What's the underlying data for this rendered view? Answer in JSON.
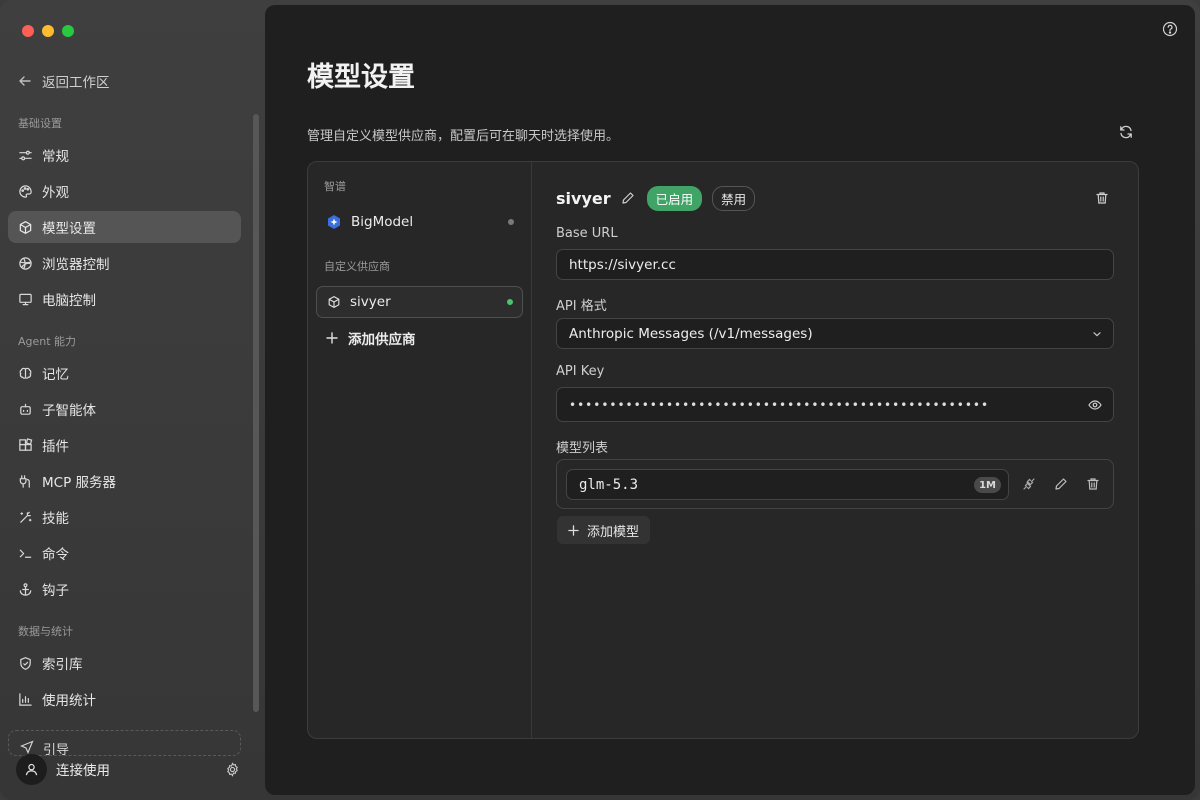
{
  "sidebar": {
    "back_label": "返回工作区",
    "sections": {
      "basic": "基础设置",
      "agent": "Agent 能力",
      "data": "数据与统计"
    },
    "items": {
      "general": "常规",
      "appearance": "外观",
      "models": "模型设置",
      "browser": "浏览器控制",
      "computer": "电脑控制",
      "memory": "记忆",
      "subagents": "子智能体",
      "plugins": "插件",
      "mcp": "MCP 服务器",
      "skills": "技能",
      "commands": "命令",
      "hooks": "钩子",
      "index": "索引库",
      "usage": "使用统计"
    },
    "bottom_peek": "引导",
    "user_label": "连接使用"
  },
  "main": {
    "title": "模型设置",
    "description": "管理自定义模型供应商，配置后可在聊天时选择使用。"
  },
  "providers": {
    "group_builtin": "智谱",
    "builtin": [
      {
        "name": "BigModel",
        "status": "inactive"
      }
    ],
    "group_custom": "自定义供应商",
    "custom": [
      {
        "name": "sivyer",
        "status": "active"
      }
    ],
    "add_label": "添加供应商"
  },
  "detail": {
    "name": "sivyer",
    "enabled_label": "已启用",
    "disable_label": "禁用",
    "base_url_label": "Base URL",
    "base_url_value": "https://sivyer.cc",
    "api_format_label": "API 格式",
    "api_format_value": "Anthropic Messages (/v1/messages)",
    "api_key_label": "API Key",
    "api_key_masked": "••••••••••••••••••••••••••••••••••••••••••••••••••••",
    "models_label": "模型列表",
    "models": [
      {
        "name": "glm-5.3",
        "context_badge": "1M"
      }
    ],
    "add_model_label": "添加模型"
  },
  "colors": {
    "accent_green": "#3fa466",
    "status_active": "#4cc26e",
    "status_inactive": "#7a7a7a",
    "main_bg": "#1f1f1f",
    "sidebar_bg": "#3d3d3d"
  }
}
